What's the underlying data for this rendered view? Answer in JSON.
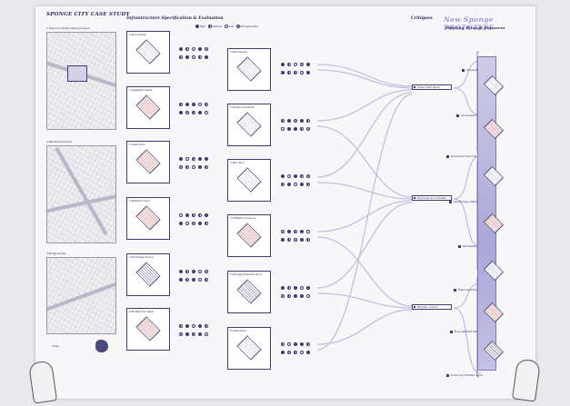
{
  "title": "SPONGE CITY CASE STUDY",
  "infra_title": "Infrastructure Specification & Evaluation",
  "critique_title": "Critiques",
  "prototype": {
    "title": "New Sponge PROTOTYPE",
    "subtitle": "Thinking Through Resources"
  },
  "legend": [
    "High",
    "Medium",
    "Low",
    "Not applicable"
  ],
  "sites": [
    {
      "label": "1  Tianjin University Weijing Campus"
    },
    {
      "label": "2  New Binhai District"
    },
    {
      "label": "3  Bridge Garden"
    }
  ],
  "sample_boxes": [
    {
      "label": "1 Rain Garden"
    },
    {
      "label": "2 Vegetated Swale"
    },
    {
      "label": "3 Green Roof"
    },
    {
      "label": "4 Retention Pond"
    },
    {
      "label": "5 Permeable Paving"
    },
    {
      "label": "6 Bioretention Basin"
    }
  ],
  "infra_boxes": [
    {
      "label": "1 Rain Garden"
    },
    {
      "label": "2 Sunken Greenbelt"
    },
    {
      "label": "3 Rain Tank"
    },
    {
      "label": "4 Infiltration Channel"
    },
    {
      "label": "5 Storage Detention Pond"
    },
    {
      "label": "6 Green Roof"
    }
  ],
  "critiques": [
    {
      "label": "Urban Heat Island"
    },
    {
      "label": "Recharge Groundwater"
    },
    {
      "label": "Pollution Control"
    }
  ],
  "prototype_items": [
    "Compost Soil",
    "Land-based Agriculture",
    "Productive Crop Cultivation",
    "Runoff Clean Water Zone",
    "Permeable Ground",
    "Filter-based Zone",
    "Flow-attached Wetland",
    "Temporary Filtration Zone"
  ],
  "map_caption": "Urban",
  "colors": {
    "accent": "#3d3c74",
    "prototype": "#9b95d2",
    "column": "#aba7d8",
    "pink": "#e1b9bd"
  }
}
